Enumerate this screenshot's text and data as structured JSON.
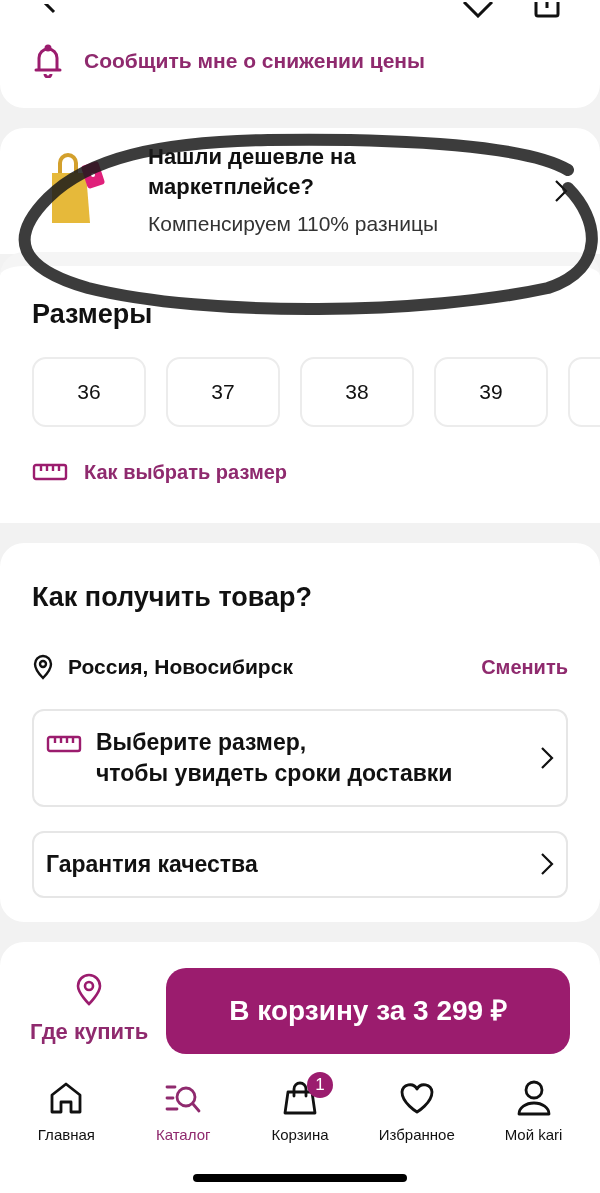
{
  "price_alert": {
    "label": "Сообщить мне о снижении цены"
  },
  "promo": {
    "title": "Нашли дешевле на маркетплейсе?",
    "subtitle": "Компенсируем 110% разницы"
  },
  "sizes": {
    "title": "Размеры",
    "items": [
      {
        "label": "36",
        "selected": false
      },
      {
        "label": "37",
        "selected": false
      },
      {
        "label": "38",
        "selected": false
      },
      {
        "label": "39",
        "selected": false
      },
      {
        "selected": false
      }
    ],
    "guide": "Как выбрать размер"
  },
  "delivery": {
    "title": "Как получить товар?",
    "location": "Россия, Новосибирск",
    "change": "Сменить",
    "options": [
      {
        "kind": "size",
        "text": "Выберите размер,\nчтобы увидеть сроки доставки"
      },
      {
        "kind": "plain",
        "text": "Гарантия качества"
      }
    ]
  },
  "actions": {
    "where_to_buy": "Где купить",
    "cart_button": "В корзину за 3 299 ₽"
  },
  "tab_bar": [
    {
      "kind": "home",
      "label": "Главная",
      "selected": false
    },
    {
      "kind": "catalog",
      "label": "Каталог",
      "selected": true
    },
    {
      "kind": "cart",
      "label": "Корзина",
      "selected": false,
      "badge": "1"
    },
    {
      "kind": "favorites",
      "label": "Избранное",
      "selected": false
    },
    {
      "kind": "profile",
      "label": "Мой kari",
      "selected": false
    }
  ]
}
